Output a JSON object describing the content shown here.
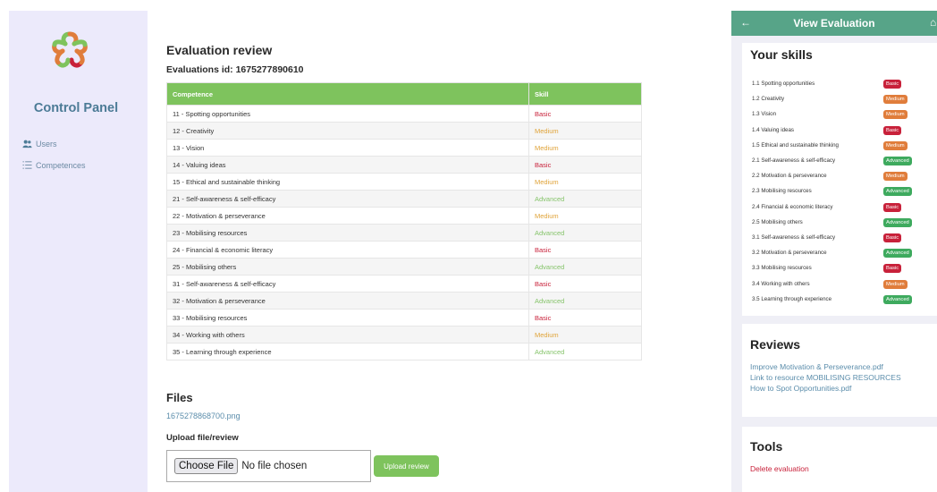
{
  "sidebar": {
    "title": "Control Panel",
    "nav": [
      {
        "label": "Users",
        "icon": "users-icon"
      },
      {
        "label": "Competences",
        "icon": "list-icon"
      }
    ]
  },
  "main": {
    "title": "Evaluation review",
    "evaluation_id": "Evaluations id: 1675277890610",
    "table_headers": {
      "competence": "Competence",
      "skill": "Skill"
    },
    "rows": [
      {
        "competence": "11 - Spotting opportunities",
        "skill": "Basic"
      },
      {
        "competence": "12 - Creativity",
        "skill": "Medium"
      },
      {
        "competence": "13 - Vision",
        "skill": "Medium"
      },
      {
        "competence": "14 - Valuing ideas",
        "skill": "Basic"
      },
      {
        "competence": "15 - Ethical and sustainable thinking",
        "skill": "Medium"
      },
      {
        "competence": "21 - Self-awareness & self-efficacy",
        "skill": "Advanced"
      },
      {
        "competence": "22 - Motivation & perseverance",
        "skill": "Medium"
      },
      {
        "competence": "23 - Mobilising resources",
        "skill": "Advanced"
      },
      {
        "competence": "24 - Financial & economic literacy",
        "skill": "Basic"
      },
      {
        "competence": "25 - Mobilising others",
        "skill": "Advanced"
      },
      {
        "competence": "31 - Self-awareness & self-efficacy",
        "skill": "Basic"
      },
      {
        "competence": "32 - Motivation & perseverance",
        "skill": "Advanced"
      },
      {
        "competence": "33 - Mobilising resources",
        "skill": "Basic"
      },
      {
        "competence": "34 - Working with others",
        "skill": "Medium"
      },
      {
        "competence": "35 - Learning through experience",
        "skill": "Advanced"
      }
    ],
    "files_title": "Files",
    "file_link": "1675278868700.png",
    "upload_title": "Upload file/review",
    "choose_file_label": "Choose File",
    "no_file_text": "No file chosen",
    "upload_button": "Upload review"
  },
  "mobile": {
    "header_title": "View Evaluation",
    "back_icon": "arrow-left-icon",
    "home_icon": "home-icon",
    "skills_title": "Your skills",
    "skills": [
      {
        "label": "1.1 Spotting opportunities",
        "level": "Basic"
      },
      {
        "label": "1.2 Creativity",
        "level": "Medium"
      },
      {
        "label": "1.3 Vision",
        "level": "Medium"
      },
      {
        "label": "1.4 Valuing ideas",
        "level": "Basic"
      },
      {
        "label": "1.5 Ethical and sustainable thinking",
        "level": "Medium"
      },
      {
        "label": "2.1 Self-awareness & self-efficacy",
        "level": "Advanced"
      },
      {
        "label": "2.2 Motivation & perseverance",
        "level": "Medium"
      },
      {
        "label": "2.3 Mobilising resources",
        "level": "Advanced"
      },
      {
        "label": "2.4 Financial & economic literacy",
        "level": "Basic"
      },
      {
        "label": "2.5 Mobilising others",
        "level": "Advanced"
      },
      {
        "label": "3.1 Self-awareness & self-efficacy",
        "level": "Basic"
      },
      {
        "label": "3.2 Motivation & perseverance",
        "level": "Advanced"
      },
      {
        "label": "3.3 Mobilising resources",
        "level": "Basic"
      },
      {
        "label": "3.4 Working with others",
        "level": "Medium"
      },
      {
        "label": "3.5 Learning through experience",
        "level": "Advanced"
      }
    ],
    "reviews_title": "Reviews",
    "reviews": [
      "Improve Motivation & Perseverance.pdf",
      "Link to resource MOBILISING RESOURCES",
      "How to Spot Opportunities.pdf"
    ],
    "tools_title": "Tools",
    "delete_label": "Delete evaluation"
  },
  "colors": {
    "accent_green": "#7ec35d",
    "header_teal": "#57a488",
    "basic": "#c8213a",
    "medium": "#e07d3b",
    "advanced": "#3eaa5e",
    "link": "#5b8dab"
  }
}
